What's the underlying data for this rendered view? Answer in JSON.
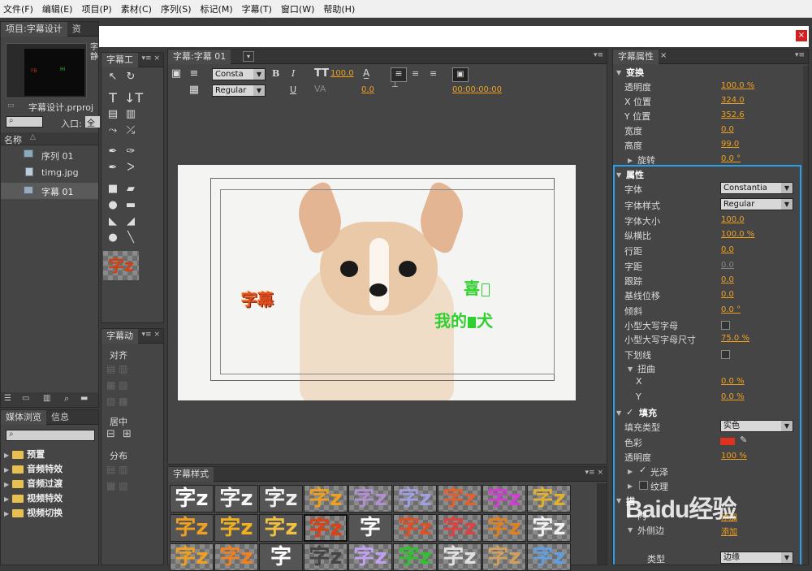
{
  "menu": [
    "文件(F)",
    "编辑(E)",
    "项目(P)",
    "素材(C)",
    "序列(S)",
    "标记(M)",
    "字幕(T)",
    "窗口(W)",
    "帮助(H)"
  ],
  "project": {
    "tab": "项目:字幕设计",
    "tab2": "资",
    "thumb_side": "字 静",
    "filename": "字幕设计.prproj",
    "entry_label": "入口:",
    "entry_value": "全",
    "column_name": "名称",
    "items": [
      {
        "label": "序列 01",
        "icon": "sequence-icon"
      },
      {
        "label": "timg.jpg",
        "icon": "image-file-icon"
      },
      {
        "label": "字幕 01",
        "icon": "title-file-icon"
      }
    ]
  },
  "browser": {
    "tabs": [
      "媒体浏览",
      "信息"
    ],
    "items": [
      "预置",
      "音频特效",
      "音频过渡",
      "视频特效",
      "视频切换"
    ]
  },
  "title_tools": {
    "tab": "字幕工"
  },
  "title_actions": {
    "tab": "字幕动",
    "align": "对齐",
    "center": "居中",
    "distribute": "分布"
  },
  "designer": {
    "tab": "字幕:字幕 01",
    "font_family": "Consta",
    "font_style": "Regular",
    "font_size": "100.0",
    "kerning": "0.0",
    "timecode": "00:00:00:00",
    "bold": "B",
    "italic": "I",
    "underline": "U"
  },
  "canvas": {
    "text_left": "字幕",
    "text_right1": "喜",
    "text_right2": "我的",
    "text_right3": "犬"
  },
  "styles": {
    "tab": "字幕样式",
    "swatch_text": "字z",
    "swatch_alt": "字"
  },
  "properties": {
    "tab": "字幕属性",
    "transform": "变换",
    "rows_transform": [
      {
        "label": "透明度",
        "value": "100.0 %"
      },
      {
        "label": "X 位置",
        "value": "324.0"
      },
      {
        "label": "Y 位置",
        "value": "352.6"
      },
      {
        "label": "宽度",
        "value": "0.0"
      },
      {
        "label": "高度",
        "value": "99.0"
      },
      {
        "label": "旋转",
        "value": "0.0 °"
      }
    ],
    "attributes": "属性",
    "font_label": "字体",
    "font_value": "Constantia",
    "style_label": "字体样式",
    "style_value": "Regular",
    "rows_attr": [
      {
        "label": "字体大小",
        "value": "100.0"
      },
      {
        "label": "纵横比",
        "value": "100.0 %"
      },
      {
        "label": "行距",
        "value": "0.0"
      },
      {
        "label": "字距",
        "value": "0.0"
      },
      {
        "label": "跟踪",
        "value": "0.0"
      },
      {
        "label": "基线位移",
        "value": "0.0"
      },
      {
        "label": "倾斜",
        "value": "0.0 °"
      }
    ],
    "smallcaps": "小型大写字母",
    "smallcaps_size": "小型大写字母尺寸",
    "smallcaps_size_value": "75.0 %",
    "underline": "下划线",
    "distort": "扭曲",
    "distort_x": "X",
    "distort_x_value": "0.0 %",
    "distort_y": "Y",
    "distort_y_value": "0.0 %",
    "fill": "填充",
    "fill_type": "填充类型",
    "fill_type_value": "实色",
    "color": "色彩",
    "color_hex": "#e03020",
    "opacity": "透明度",
    "opacity_value": "100 %",
    "gloss": "光泽",
    "texture": "纹理",
    "stroke": "描",
    "inner": "内",
    "outer": "外侧边",
    "type": "类型",
    "type_value": "边缘",
    "add1": "添加",
    "add2": "添加"
  },
  "watermark": "Baidu经验",
  "colors": {
    "accent": "#2aa0e8",
    "value": "#f0a020"
  }
}
